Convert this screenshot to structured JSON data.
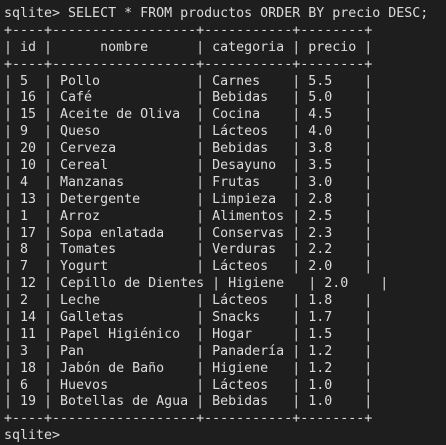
{
  "terminal": {
    "command_line": "sqlite> SELECT * FROM productos ORDER BY precio DESC;",
    "border_line": "+----+------------------+-----------+--------+",
    "header": {
      "line": "| id |      nombre      | categoria | precio |"
    },
    "rows": [
      "| 5  | Pollo            | Carnes    | 5.5    |",
      "| 16 | Café             | Bebidas   | 5.0    |",
      "| 15 | Aceite de Oliva  | Cocina    | 4.5    |",
      "| 9  | Queso            | Lácteos   | 4.0    |",
      "| 20 | Cerveza          | Bebidas   | 3.8    |",
      "| 10 | Cereal           | Desayuno  | 3.5    |",
      "| 4  | Manzanas         | Frutas    | 3.0    |",
      "| 13 | Detergente       | Limpieza  | 2.8    |",
      "| 1  | Arroz            | Alimentos | 2.5    |",
      "| 17 | Sopa enlatada    | Conservas | 2.3    |",
      "| 8  | Tomates          | Verduras  | 2.2    |",
      "| 7  | Yogurt           | Lácteos   | 2.0    |",
      "| 12 | Cepillo de Dientes | Higiene   | 2.0    |",
      "| 2  | Leche            | Lácteos   | 1.8    |",
      "| 14 | Galletas         | Snacks    | 1.7    |",
      "| 11 | Papel Higiénico  | Hogar     | 1.5    |",
      "| 3  | Pan              | Panadería | 1.2    |",
      "| 18 | Jabón de Baño    | Higiene   | 1.2    |",
      "| 6  | Huevos           | Lácteos   | 1.0    |",
      "| 19 | Botellas de Agua | Bebidas   | 1.0    |"
    ],
    "prompt_tail": "sqlite> "
  }
}
